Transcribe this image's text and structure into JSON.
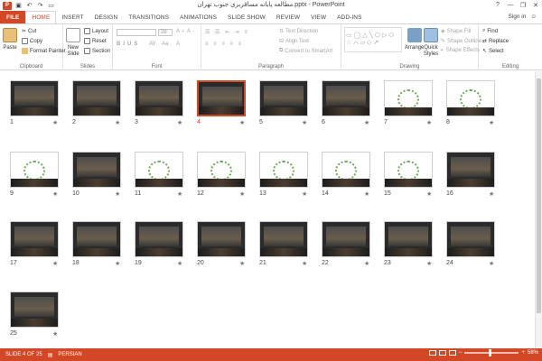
{
  "window": {
    "title": "مطالعه پایانه مسافربری جنوب تهران.pptx - PowerPoint",
    "app_icon": "P",
    "controls": [
      "?",
      "—",
      "❐",
      "✕"
    ]
  },
  "qat": [
    "save-icon",
    "undo-icon",
    "redo-icon",
    "slideshow-icon"
  ],
  "tabs": [
    "FILE",
    "HOME",
    "INSERT",
    "DESIGN",
    "TRANSITIONS",
    "ANIMATIONS",
    "SLIDE SHOW",
    "REVIEW",
    "VIEW",
    "ADD-INS"
  ],
  "active_tab": "HOME",
  "signin": "Sign in",
  "ribbon": {
    "clipboard": {
      "label": "Clipboard",
      "paste": "Paste",
      "cut": "Cut",
      "copy": "Copy",
      "format_painter": "Format Painter"
    },
    "slides": {
      "label": "Slides",
      "new_slide": "New Slide",
      "layout": "Layout",
      "reset": "Reset",
      "section": "Section"
    },
    "font": {
      "label": "Font",
      "size": "28"
    },
    "paragraph": {
      "label": "Paragraph",
      "text_direction": "Text Direction",
      "align_text": "Align Text",
      "convert_smartart": "Convert to SmartArt"
    },
    "drawing": {
      "label": "Drawing",
      "arrange": "Arrange",
      "quick_styles": "Quick Styles",
      "shape_fill": "Shape Fill",
      "shape_outline": "Shape Outline",
      "shape_effects": "Shape Effects"
    },
    "editing": {
      "label": "Editing",
      "find": "Find",
      "replace": "Replace",
      "select": "Select"
    }
  },
  "slides": [
    "1",
    "2",
    "3",
    "4",
    "5",
    "6",
    "7",
    "8",
    "9",
    "10",
    "11",
    "12",
    "13",
    "14",
    "15",
    "16",
    "17",
    "18",
    "19",
    "20",
    "21",
    "22",
    "23",
    "24",
    "25"
  ],
  "selected_slide": "4",
  "star": "★",
  "status": {
    "slide": "SLIDE 4 OF 25",
    "language": "PERSIAN",
    "zoom": "58%",
    "zoom_fraction": 0.58,
    "minus": "−",
    "plus": "+"
  },
  "colors": {
    "accent": "#d24726",
    "thumb_dark": "#2b2b2b",
    "thumb_white": "#ffffff"
  }
}
